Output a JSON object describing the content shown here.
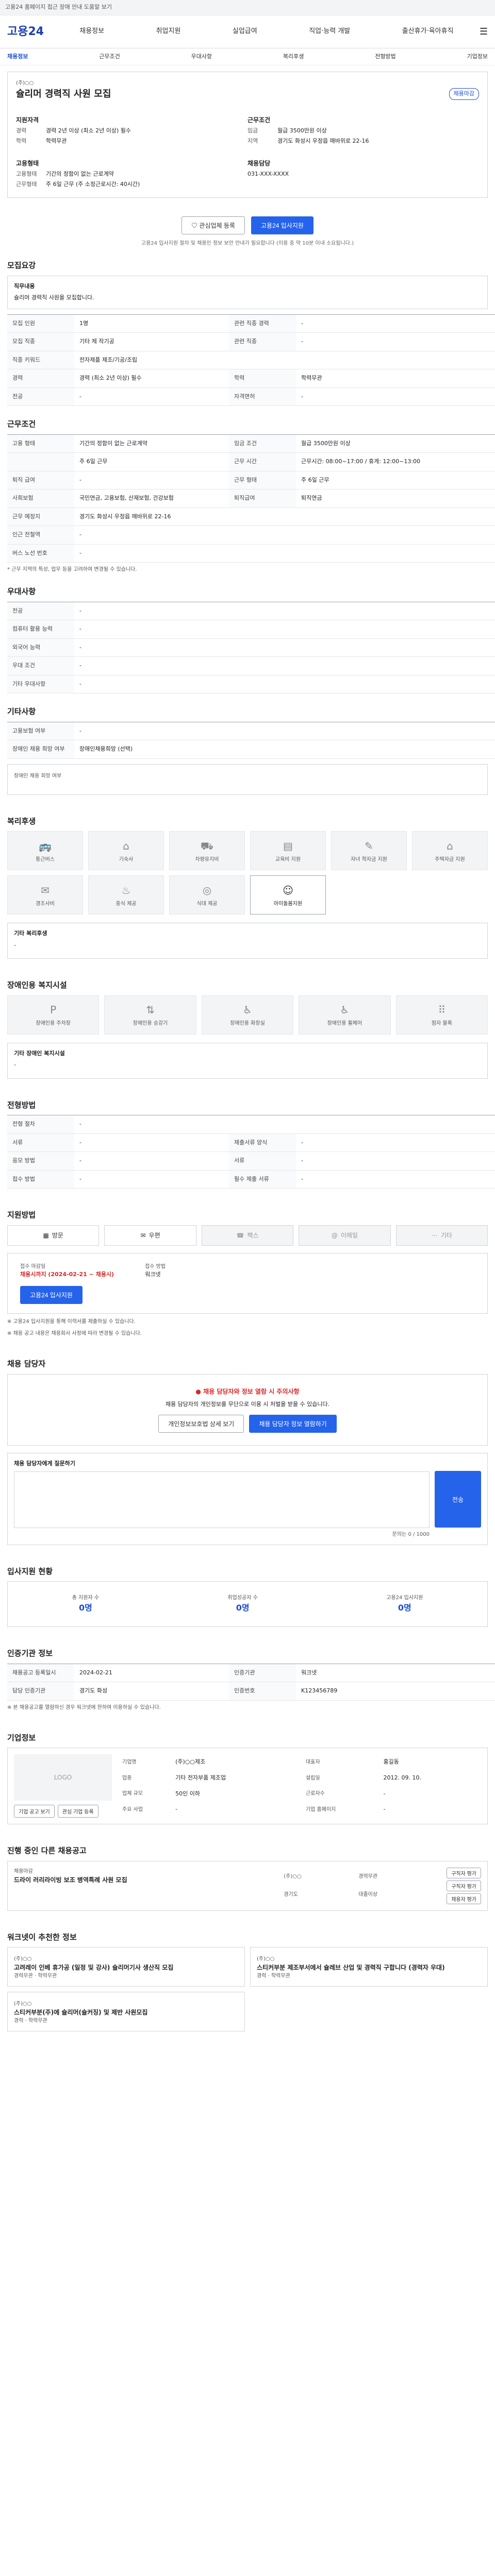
{
  "topbar": {
    "notice": "고용24 홈페이지 접근 장애 안내 도움말 보기"
  },
  "header": {
    "logo": "고용24",
    "nav": [
      "채용정보",
      "취업지원",
      "실업급여",
      "직업·능력 개발",
      "출산휴가·육아휴직"
    ]
  },
  "subnav": [
    "채용정보",
    "근무조건",
    "우대사항",
    "복리후생",
    "전형방법",
    "기업정보"
  ],
  "job": {
    "company_label": "(주)○○",
    "title": "슐리머 경력직 사원 모집",
    "badge": "채용마감",
    "left_head": "지원자격",
    "exp_label": "경력",
    "exp_value": "경력 2년 이상 (최소 2년 이상) 필수",
    "edu_label": "학력",
    "edu_value": "학력무관",
    "emp_head": "고용형태",
    "emp_k1": "고용형태",
    "emp_v1": "기간의 정함이 없는 근로계약",
    "emp_k2": "근무형태",
    "emp_v2": "주 6일 근무 (주 소정근로시간: 40시간)",
    "right_head": "근무조건",
    "pay_label": "임금",
    "pay_value": "월급 3500만원 이상",
    "loc_label": "지역",
    "loc_value": "경기도 화성시 우정읍 매바위로 22-16",
    "manager_head": "채용담당",
    "manager_value": "031-XXX-XXXX",
    "btn_save": "관심업체 등록",
    "btn_apply": "고용24 입사지원",
    "note": "고용24 입사지원 절차 및 채용인 정보 보안 안내가 필요합니다 (이용 중 약 10분 이내 소요됩니다.)"
  },
  "req": {
    "title": "모집요강",
    "box_h": "직무내용",
    "box_v": "슐리머 경력직 사원을 모집합니다.",
    "rows": [
      [
        "모집 인원",
        "1명",
        "관련 직종 경력",
        "-"
      ],
      [
        "모집 직종",
        "기타 제 작기공",
        "관련 직종",
        "-"
      ],
      [
        "직종 키워드",
        "전자제품 제조/기공/조립",
        "",
        ""
      ],
      [
        "경력",
        "경력 (최소 2년 이상) 필수",
        "학력",
        "학력무관"
      ],
      [
        "전공",
        "-",
        "자격면허",
        "-"
      ]
    ]
  },
  "cond": {
    "title": "근무조건",
    "rows": [
      [
        "고용 형태",
        "기간의 정함이 없는 근로계약",
        "임금 조건",
        "월급 3500만원 이상"
      ],
      [
        "",
        "주 6일 근무",
        "근무 시간",
        "근무시간: 08:00~17:00 / 휴게: 12:00~13:00"
      ],
      [
        "퇴직 급여",
        "-",
        "근무 형태",
        "주 6일 근무"
      ],
      [
        "사회보험",
        "국민연금, 고용보험, 산재보험, 건강보험",
        "퇴직급여",
        "퇴직연금"
      ],
      [
        "근무 예정지",
        "경기도 화성시 우정읍 매바위로 22-16",
        "",
        ""
      ],
      [
        "인근 전철역",
        "-",
        "",
        ""
      ],
      [
        "버스 노선 번호",
        "-",
        "",
        ""
      ]
    ],
    "note": "* 근무 지역의 특성, 업무 등을 고려하여 변경될 수 있습니다."
  },
  "pref": {
    "title": "우대사항",
    "rows": [
      [
        "전공",
        "-"
      ],
      [
        "컴퓨터 활용 능력",
        "-"
      ],
      [
        "외국어 능력",
        "-"
      ],
      [
        "우대 조건",
        "-"
      ],
      [
        "기타 우대사항",
        "-"
      ]
    ]
  },
  "etc": {
    "title": "기타사항",
    "rows": [
      [
        "고용보험 여부",
        "-"
      ],
      [
        "장애인 채용 희망 여부",
        "장애인채용희망 (선택)"
      ]
    ],
    "note": "장애인 채용 희망 여부"
  },
  "welfare": {
    "title": "복리후생",
    "items": [
      "통근버스",
      "기숙사",
      "차량유지비",
      "교육비 지원",
      "자녀 학자금 지원",
      "주택자금 지원",
      "경조사비",
      "중식 제공",
      "식대 제공",
      "아이돌봄지원"
    ],
    "on": "아이돌봄지원",
    "box_h": "기타 복리후생",
    "box_v": "-"
  },
  "disability": {
    "title": "장애인용 복지시설",
    "items": [
      "장애인용 주차장",
      "장애인용 승강기",
      "장애인용 화장실",
      "장애인용 휠체어",
      "점자 블록"
    ],
    "box_h": "기타 장애인 복지시설",
    "box_v": "-"
  },
  "screening": {
    "title": "전형방법",
    "rows": [
      [
        "전형 절차",
        "-",
        "",
        ""
      ],
      [
        "서류",
        "-",
        "제출서류 양식",
        "-"
      ],
      [
        "응모 방법",
        "-",
        "서류",
        "-"
      ],
      [
        "접수 방법",
        "-",
        "필수 제출 서류",
        "-"
      ]
    ]
  },
  "apply": {
    "title": "지원방법",
    "methods": [
      "방문",
      "우편",
      "팩스",
      "이메일",
      "기타"
    ],
    "dead_label": "접수 마감일",
    "dead_value": "채용시까지 (2024-02-21 ~ 채용시)",
    "tdesc_label": "접수 방법",
    "tdesc_value": "워크넷",
    "apply_btn": "고용24 입사지원",
    "notes": [
      "※ 고용24 입사지원을 통해 이력서를 제출하실 수 있습니다.",
      "※ 채용 공고 내용은 채용회사 사정에 따라 변경될 수 있습니다."
    ]
  },
  "caution": {
    "title": "채용 담당자",
    "warn": "채용 담당자와 정보 열람 시 주의사항",
    "desc": "채용 담당자의 개인정보를 무단으로 이용 시 처벌을 받을 수 있습니다.",
    "btn1": "개인정보보호법 상세 보기",
    "btn2": "채용 담당자 정보 열람하기",
    "contact_head": "채용 담당자에게 질문하기",
    "contact_note": "문의는 0 / 1000",
    "btn_send": "전송"
  },
  "stats": {
    "title": "입사지원 현황",
    "items": [
      [
        "총 지원자 수",
        "0명"
      ],
      [
        "취업성공자 수",
        "0명"
      ],
      [
        "고용24 입사지원",
        "0명"
      ]
    ]
  },
  "info": {
    "title": "인증기관 정보",
    "rows": [
      [
        "채용공고 등록일시",
        "2024-02-21",
        "인증기관",
        "워크넷"
      ],
      [
        "담당 인증기관",
        "경기도 화성",
        "인증번호",
        "K123456789"
      ]
    ],
    "note": "※ 본 채용공고를 열람하신 경우 워크넷에 한하여 이용하실 수 있습니다."
  },
  "company": {
    "title": "기업정보",
    "logo": "LOGO",
    "rows": [
      [
        "기업명",
        "(주)○○제조",
        "대표자",
        "홍길동"
      ],
      [
        "업종",
        "기타 전자부품 제조업",
        "설립일",
        "2012. 09. 10."
      ],
      [
        "업체 규모",
        "50인 이하",
        "근로자수",
        "-"
      ],
      [
        "주요 사업",
        "-",
        "기업 홈페이지",
        "-"
      ]
    ],
    "btn1": "기업 공고 보기",
    "btn2": "관심 기업 등록"
  },
  "other": {
    "title": "진행 중인 다른 채용공고",
    "item_title": "드라이 러리라이빙 보조 병역특례 사원 모집",
    "item_sub": "채용마감",
    "links": [
      "구직자 평가",
      "구직자 평가",
      "채용자 평가"
    ],
    "rows": [
      [
        "(주)○○",
        "경력무관"
      ],
      [
        "경기도",
        "대졸이상"
      ]
    ]
  },
  "recommend": {
    "title": "워크넷이 추천한 정보",
    "cards": [
      {
        "tag": "(주)○○",
        "title": "고려레이 인베 휴가공 (일정 및 강사) 슐리머기사 생산직 모집",
        "t1": "경력무관",
        "t2": "학력무관"
      },
      {
        "tag": "(주)○○",
        "title": "스티커부분 제조부서에서 슐레브 산업 및 경력직 구합니다 (경력자 우대)",
        "t1": "경력",
        "t2": "학력무관"
      },
      {
        "tag": "(주)○○",
        "title": "스티커부분(주)에 슐리머(슐커징) 및 제반 사원모집",
        "t1": "경력",
        "t2": "학력무관"
      }
    ]
  }
}
